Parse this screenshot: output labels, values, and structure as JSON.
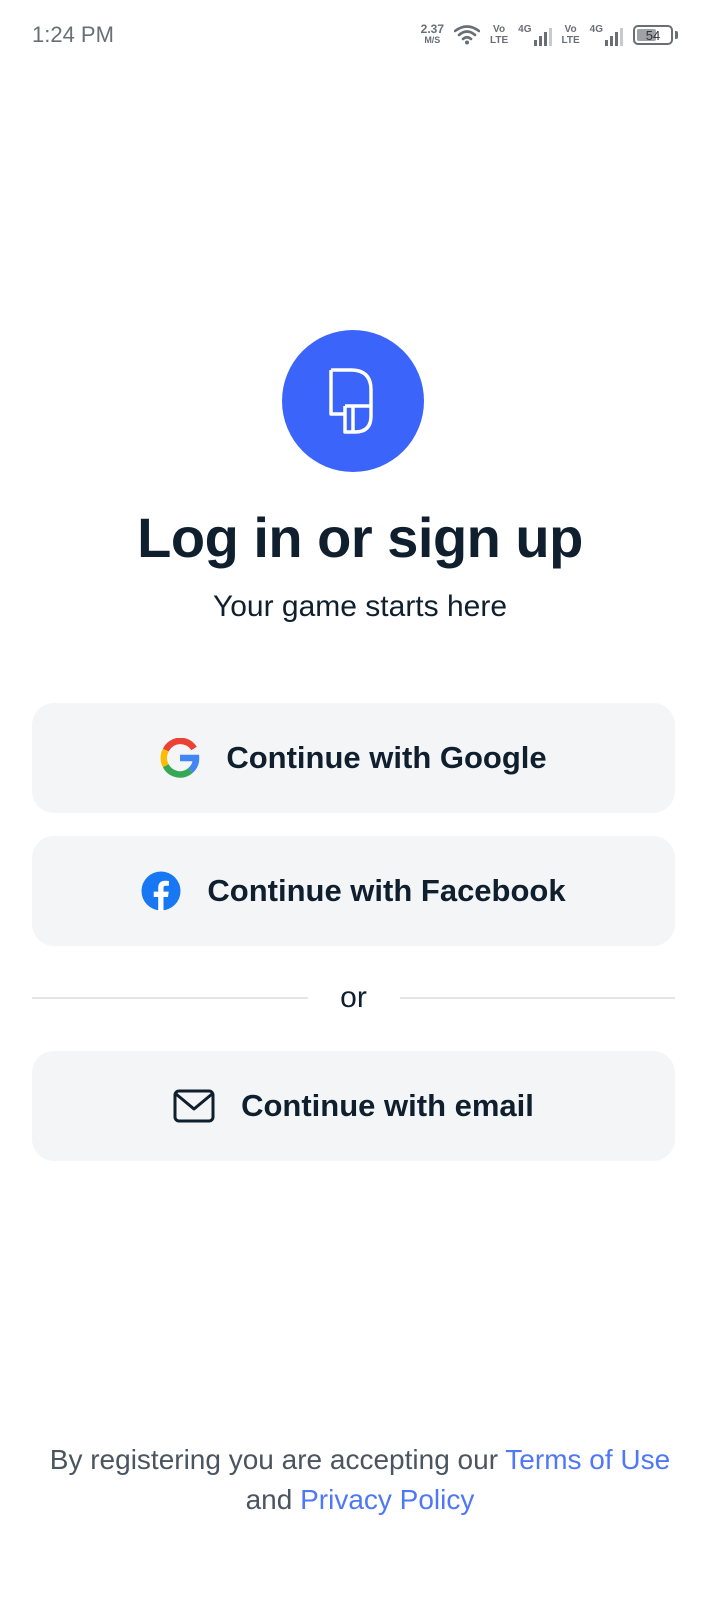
{
  "status_bar": {
    "time": "1:24 PM",
    "net_speed_value": "2.37",
    "net_speed_unit": "M/S",
    "volte_top": "Vo",
    "volte_bottom": "LTE",
    "network_type": "4G",
    "battery_level": "54"
  },
  "logo": {
    "icon": "app-logo-icon",
    "color": "#3b64fb"
  },
  "header": {
    "title": "Log in or sign up",
    "subtitle": "Your game starts here"
  },
  "auth": {
    "google_label": "Continue with Google",
    "facebook_label": "Continue with Facebook",
    "divider_label": "or",
    "email_label": "Continue with email"
  },
  "footer": {
    "prefix": "By registering you are accepting our ",
    "terms_link": "Terms of Use",
    "middle": "and ",
    "privacy_link": "Privacy Policy"
  },
  "colors": {
    "accent": "#3b64fb",
    "link": "#4f78f7",
    "button_bg": "#f3f5f7",
    "text": "#0f1f2e"
  }
}
